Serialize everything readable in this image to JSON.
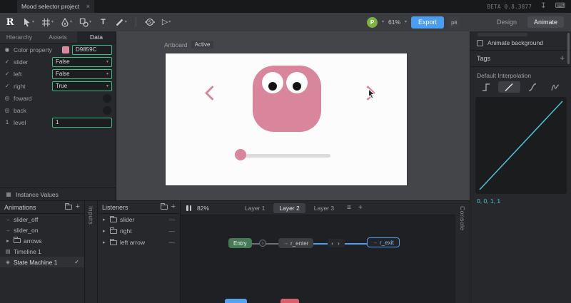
{
  "titlebar": {
    "tab_title": "Mood selector project",
    "beta_version": "BETA 0.8.3877"
  },
  "toolbar": {
    "logo": "R",
    "avatar_initial": "P",
    "zoom": "61%",
    "export_label": "Export",
    "badge": "p8",
    "design_label": "Design",
    "animate_label": "Animate"
  },
  "left_panel": {
    "tabs": [
      "Hierarchy",
      "Assets",
      "Data"
    ],
    "rows": [
      {
        "label": "Color property",
        "value": "D9859C"
      },
      {
        "label": "slider",
        "value": "False"
      },
      {
        "label": "left",
        "value": "False"
      },
      {
        "label": "right",
        "value": "True"
      },
      {
        "label": "foward"
      },
      {
        "label": "back"
      },
      {
        "label": "level",
        "value": "1"
      }
    ],
    "instance_values_label": "Instance Values"
  },
  "stage": {
    "artboard_label": "Artboard",
    "active_label": "Active"
  },
  "right_panel": {
    "animate_background_label": "Animate background",
    "tags_label": "Tags",
    "default_interpolation_label": "Default Interpolation",
    "curve_values": "0, 0, 1, 1"
  },
  "animations_panel": {
    "title": "Animations",
    "items": [
      "slider_off",
      "slider_on",
      "arrows",
      "Timeline 1",
      "State Machine 1"
    ]
  },
  "inputs_panel": {
    "title": "Inputs"
  },
  "listeners_panel": {
    "title": "Listeners",
    "items": [
      "slider",
      "right",
      "left arrow"
    ]
  },
  "state_machine": {
    "zoom": "82%",
    "layers": [
      "Layer 1",
      "Layer 2",
      "Layer 3"
    ],
    "nodes": {
      "entry": "Entry",
      "enter": "r_enter",
      "exit": "r_exit"
    }
  },
  "console_panel": {
    "title": "Console"
  },
  "icons": {
    "close": "×",
    "caret_down": "▾",
    "chevron_right": "▸",
    "plus": "+",
    "menu": "≡",
    "check": "✓",
    "dash": "—",
    "download": "↧",
    "keyboard": "⌨",
    "color_prop": "◉",
    "bool_prop": "✓",
    "trigger_prop": "◎",
    "number_prop": "1",
    "anim": "→",
    "timeline": "▤",
    "state_machine": "◈",
    "instance": "▦",
    "transition_chevrons": "‹ ›",
    "wire_arrow": "›",
    "text_tool": "T",
    "play_tool": "▷"
  },
  "colors": {
    "accent_pink": "#D9859C",
    "export_blue": "#4B9DF2",
    "wire_blue": "#4F9FF0",
    "curve_cyan": "#4FC3D4",
    "binding_green": "#3FBD85",
    "entry_green": "#457A57"
  }
}
